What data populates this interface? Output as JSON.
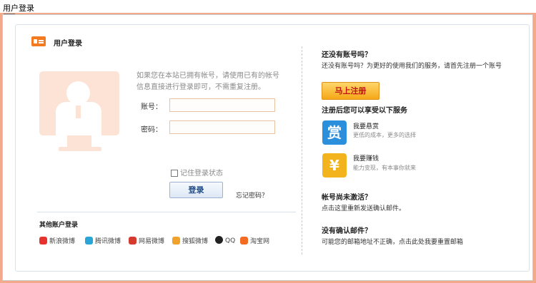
{
  "window": {
    "title": "用户登录",
    "close_glyph": "×"
  },
  "header": {
    "title": "用户登录"
  },
  "login": {
    "intro": "如果您在本站已拥有帐号，请使用已有的帐号信息直接进行登录即可，不需重复注册。",
    "account_label": "账号：",
    "password_label": "密码：",
    "remember_label": "记住登录状态",
    "login_button": "登录",
    "forgot_link": "忘记密码？"
  },
  "other_login": {
    "title": "其他账户登录",
    "providers": [
      {
        "name": "新浪微博",
        "color": "#e8322d"
      },
      {
        "name": "腾讯微博",
        "color": "#2aa5d8"
      },
      {
        "name": "网易微博",
        "color": "#d53a2f"
      },
      {
        "name": "搜狐微博",
        "color": "#f0a22b"
      },
      {
        "name": "QQ",
        "color": "#222222"
      },
      {
        "name": "淘宝网",
        "color": "#f46b24"
      }
    ]
  },
  "register": {
    "heading": "还没有账号吗？",
    "text": "还没有账号吗？为更好的使用我们的服务，请首先注册一个账号",
    "button": "马上注册"
  },
  "services": {
    "heading": "注册后您可以享受以下服务",
    "items": [
      {
        "icon": "赏",
        "name": "我要悬赏",
        "desc": "更低的成本，更多的选择",
        "color": "#2c8fdc"
      },
      {
        "icon": "¥",
        "name": "我要赚钱",
        "desc": "能力变现，有本事你就来",
        "color": "#f2b31c"
      }
    ]
  },
  "activate": {
    "heading": "帐号尚未激活？",
    "text": "点击这里重新发送确认邮件。"
  },
  "no_email": {
    "heading": "没有确认邮件？",
    "text": "可能您的邮箱地址不正确，点击此处我要重置邮箱"
  }
}
